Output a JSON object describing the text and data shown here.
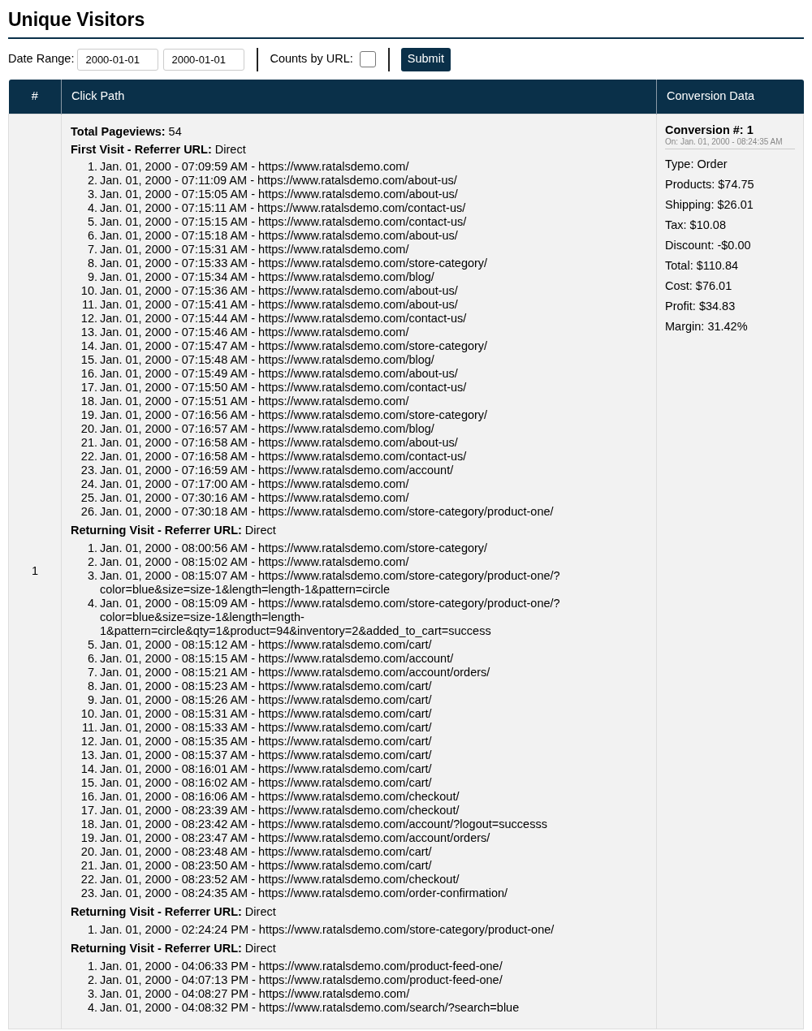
{
  "title": "Unique Visitors",
  "filters": {
    "date_range_label": "Date Range:",
    "date_from": "2000-01-01",
    "date_to": "2000-01-01",
    "counts_label": "Counts by URL:",
    "counts_checked": false,
    "submit": "Submit"
  },
  "table": {
    "columns": [
      "#",
      "Click Path",
      "Conversion Data"
    ],
    "rows": [
      {
        "number": "1",
        "total_pageviews": "**Total Pageviews:** 54",
        "visits": [
          {
            "heading": "**First Visit - Referrer URL:** Direct",
            "items": [
              {
                "num": "1.",
                "text": "Jan. 01, 2000 - 07:09:59 AM - https://www.ratalsdemo.com/"
              },
              {
                "num": "2.",
                "text": "Jan. 01, 2000 - 07:11:09 AM - https://www.ratalsdemo.com/about-us/"
              },
              {
                "num": "3.",
                "text": "Jan. 01, 2000 - 07:15:05 AM - https://www.ratalsdemo.com/about-us/"
              },
              {
                "num": "4.",
                "text": "Jan. 01, 2000 - 07:15:11 AM - https://www.ratalsdemo.com/contact-us/"
              },
              {
                "num": "5.",
                "text": "Jan. 01, 2000 - 07:15:15 AM - https://www.ratalsdemo.com/contact-us/"
              },
              {
                "num": "6.",
                "text": "Jan. 01, 2000 - 07:15:18 AM - https://www.ratalsdemo.com/about-us/"
              },
              {
                "num": "7.",
                "text": "Jan. 01, 2000 - 07:15:31 AM - https://www.ratalsdemo.com/"
              },
              {
                "num": "8.",
                "text": "Jan. 01, 2000 - 07:15:33 AM - https://www.ratalsdemo.com/store-category/"
              },
              {
                "num": "9.",
                "text": "Jan. 01, 2000 - 07:15:34 AM - https://www.ratalsdemo.com/blog/"
              },
              {
                "num": "10.",
                "text": "Jan. 01, 2000 - 07:15:36 AM - https://www.ratalsdemo.com/about-us/"
              },
              {
                "num": "11.",
                "text": "Jan. 01, 2000 - 07:15:41 AM - https://www.ratalsdemo.com/about-us/"
              },
              {
                "num": "12.",
                "text": "Jan. 01, 2000 - 07:15:44 AM - https://www.ratalsdemo.com/contact-us/"
              },
              {
                "num": "13.",
                "text": "Jan. 01, 2000 - 07:15:46 AM - https://www.ratalsdemo.com/"
              },
              {
                "num": "14.",
                "text": "Jan. 01, 2000 - 07:15:47 AM - https://www.ratalsdemo.com/store-category/"
              },
              {
                "num": "15.",
                "text": "Jan. 01, 2000 - 07:15:48 AM - https://www.ratalsdemo.com/blog/"
              },
              {
                "num": "16.",
                "text": "Jan. 01, 2000 - 07:15:49 AM - https://www.ratalsdemo.com/about-us/"
              },
              {
                "num": "17.",
                "text": "Jan. 01, 2000 - 07:15:50 AM - https://www.ratalsdemo.com/contact-us/"
              },
              {
                "num": "18.",
                "text": "Jan. 01, 2000 - 07:15:51 AM - https://www.ratalsdemo.com/"
              },
              {
                "num": "19.",
                "text": "Jan. 01, 2000 - 07:16:56 AM - https://www.ratalsdemo.com/store-category/"
              },
              {
                "num": "20.",
                "text": "Jan. 01, 2000 - 07:16:57 AM - https://www.ratalsdemo.com/blog/"
              },
              {
                "num": "21.",
                "text": "Jan. 01, 2000 - 07:16:58 AM - https://www.ratalsdemo.com/about-us/"
              },
              {
                "num": "22.",
                "text": "Jan. 01, 2000 - 07:16:58 AM - https://www.ratalsdemo.com/contact-us/"
              },
              {
                "num": "23.",
                "text": "Jan. 01, 2000 - 07:16:59 AM - https://www.ratalsdemo.com/account/"
              },
              {
                "num": "24.",
                "text": "Jan. 01, 2000 - 07:17:00 AM - https://www.ratalsdemo.com/"
              },
              {
                "num": "25.",
                "text": "Jan. 01, 2000 - 07:30:16 AM - https://www.ratalsdemo.com/"
              },
              {
                "num": "26.",
                "text": "Jan. 01, 2000 - 07:30:18 AM - https://www.ratalsdemo.com/store-category/product-one/"
              }
            ]
          },
          {
            "heading": "**Returning Visit - Referrer URL:** Direct",
            "items": [
              {
                "num": "1.",
                "text": "Jan. 01, 2000 - 08:00:56 AM - https://www.ratalsdemo.com/store-category/"
              },
              {
                "num": "2.",
                "text": "Jan. 01, 2000 - 08:15:02 AM - https://www.ratalsdemo.com/"
              },
              {
                "num": "3.",
                "text": "Jan. 01, 2000 - 08:15:07 AM - https://www.ratalsdemo.com/store-category/product-one/?color=blue&size=size-1&length=length-1&pattern=circle"
              },
              {
                "num": "4.",
                "text": "Jan. 01, 2000 - 08:15:09 AM - https://www.ratalsdemo.com/store-category/product-one/?color=blue&size=size-1&length=length-1&pattern=circle&qty=1&product=94&inventory=2&added_to_cart=success"
              },
              {
                "num": "5.",
                "text": "Jan. 01, 2000 - 08:15:12 AM - https://www.ratalsdemo.com/cart/"
              },
              {
                "num": "6.",
                "text": "Jan. 01, 2000 - 08:15:15 AM - https://www.ratalsdemo.com/account/"
              },
              {
                "num": "7.",
                "text": "Jan. 01, 2000 - 08:15:21 AM - https://www.ratalsdemo.com/account/orders/"
              },
              {
                "num": "8.",
                "text": "Jan. 01, 2000 - 08:15:23 AM - https://www.ratalsdemo.com/cart/"
              },
              {
                "num": "9.",
                "text": "Jan. 01, 2000 - 08:15:26 AM - https://www.ratalsdemo.com/cart/"
              },
              {
                "num": "10.",
                "text": "Jan. 01, 2000 - 08:15:31 AM - https://www.ratalsdemo.com/cart/"
              },
              {
                "num": "11.",
                "text": "Jan. 01, 2000 - 08:15:33 AM - https://www.ratalsdemo.com/cart/"
              },
              {
                "num": "12.",
                "text": "Jan. 01, 2000 - 08:15:35 AM - https://www.ratalsdemo.com/cart/"
              },
              {
                "num": "13.",
                "text": "Jan. 01, 2000 - 08:15:37 AM - https://www.ratalsdemo.com/cart/"
              },
              {
                "num": "14.",
                "text": "Jan. 01, 2000 - 08:16:01 AM - https://www.ratalsdemo.com/cart/"
              },
              {
                "num": "15.",
                "text": "Jan. 01, 2000 - 08:16:02 AM - https://www.ratalsdemo.com/cart/"
              },
              {
                "num": "16.",
                "text": "Jan. 01, 2000 - 08:16:06 AM - https://www.ratalsdemo.com/checkout/"
              },
              {
                "num": "17.",
                "text": "Jan. 01, 2000 - 08:23:39 AM - https://www.ratalsdemo.com/checkout/"
              },
              {
                "num": "18.",
                "text": "Jan. 01, 2000 - 08:23:42 AM - https://www.ratalsdemo.com/account/?logout=successs"
              },
              {
                "num": "19.",
                "text": "Jan. 01, 2000 - 08:23:47 AM - https://www.ratalsdemo.com/account/orders/"
              },
              {
                "num": "20.",
                "text": "Jan. 01, 2000 - 08:23:48 AM - https://www.ratalsdemo.com/cart/"
              },
              {
                "num": "21.",
                "text": "Jan. 01, 2000 - 08:23:50 AM - https://www.ratalsdemo.com/cart/"
              },
              {
                "num": "22.",
                "text": "Jan. 01, 2000 - 08:23:52 AM - https://www.ratalsdemo.com/checkout/"
              },
              {
                "num": "23.",
                "text": "Jan. 01, 2000 - 08:24:35 AM - https://www.ratalsdemo.com/order-confirmation/"
              }
            ]
          },
          {
            "heading": "**Returning Visit - Referrer URL:** Direct",
            "items": [
              {
                "num": "1.",
                "text": "Jan. 01, 2000 - 02:24:24 PM - https://www.ratalsdemo.com/store-category/product-one/"
              }
            ]
          },
          {
            "heading": "**Returning Visit - Referrer URL:** Direct",
            "items": [
              {
                "num": "1.",
                "text": "Jan. 01, 2000 - 04:06:33 PM - https://www.ratalsdemo.com/product-feed-one/"
              },
              {
                "num": "2.",
                "text": "Jan. 01, 2000 - 04:07:13 PM - https://www.ratalsdemo.com/product-feed-one/"
              },
              {
                "num": "3.",
                "text": "Jan. 01, 2000 - 04:08:27 PM - https://www.ratalsdemo.com/"
              },
              {
                "num": "4.",
                "text": "Jan. 01, 2000 - 04:08:32 PM - https://www.ratalsdemo.com/search/?search=blue"
              }
            ]
          }
        ],
        "conversion": {
          "title": "Conversion #: 1",
          "date": "On: Jan. 01, 2000 - 08:24:35 AM",
          "details": [
            "Type: Order",
            "Products: $74.75",
            "Shipping: $26.01",
            "Tax: $10.08",
            "Discount: -$0.00",
            "Total: $110.84",
            "Cost: $76.01",
            "Profit: $34.83",
            "Margin: 31.42%"
          ]
        }
      }
    ]
  }
}
